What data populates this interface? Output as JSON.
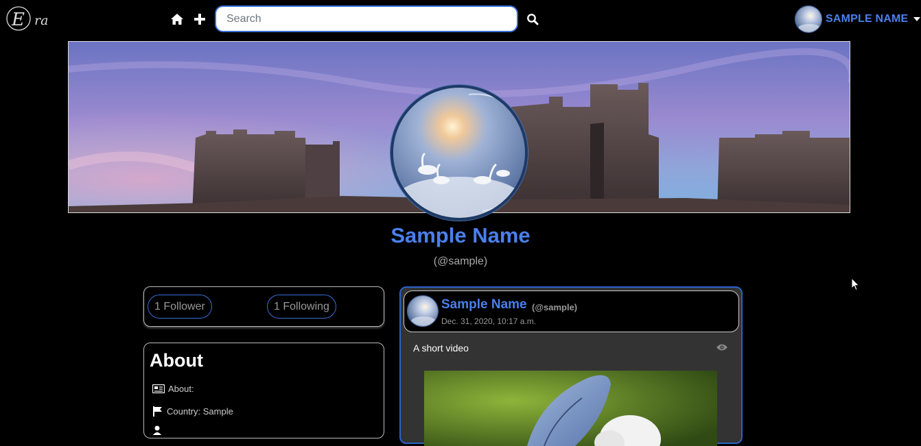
{
  "navbar": {
    "logo_text": "Era",
    "search": {
      "placeholder": "Search",
      "value": ""
    },
    "user": {
      "name": "SAMPLE NAME"
    },
    "icons": [
      "home-icon",
      "plus-icon",
      "search-icon",
      "chevron-down-icon"
    ]
  },
  "profile": {
    "display_name": "Sample Name",
    "username": "(@sample)"
  },
  "stats": {
    "followers_label": "1 Follower",
    "following_label": "1 Following"
  },
  "about": {
    "title": "About",
    "about_label": "About:",
    "country_label": "Country: Sample",
    "icons": [
      "id-card-icon",
      "flag-icon",
      "user-icon"
    ]
  },
  "post": {
    "author": "Sample Name",
    "handle": "(@sample)",
    "date": "Dec. 31, 2020, 10:17 a.m.",
    "text": "A short video",
    "icons": [
      "eye-icon"
    ]
  },
  "colors": {
    "background": "#000000",
    "accent": "#4a80ec",
    "border_blue": "#2a63c8",
    "card_bg": "#333333"
  }
}
